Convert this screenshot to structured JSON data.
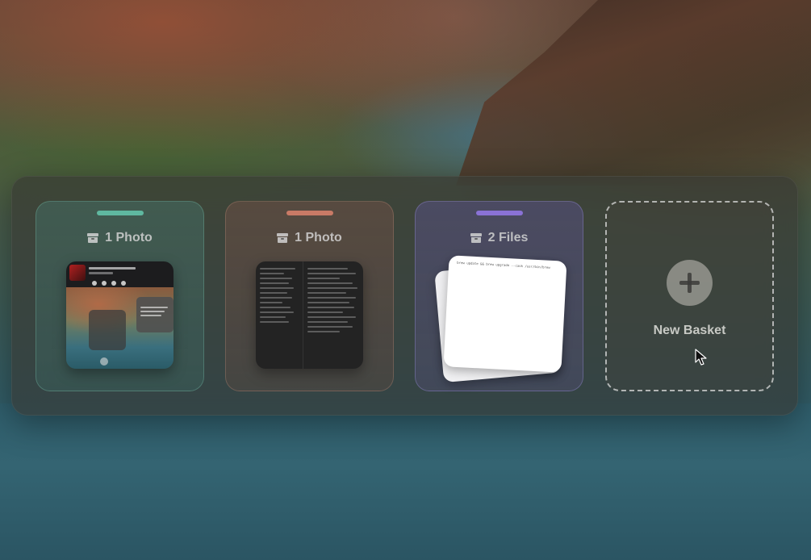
{
  "baskets": [
    {
      "title": "1 Photo",
      "accent": "#5fb8a0",
      "icon": "archive-box-icon",
      "thumbnail": "screenshot-photo"
    },
    {
      "title": "1 Photo",
      "accent": "#c97a66",
      "icon": "archive-box-icon",
      "thumbnail": "document-screenshot"
    },
    {
      "title": "2 Files",
      "accent": "#8a72d6",
      "icon": "archive-box-icon",
      "thumbnail": "stacked-files"
    }
  ],
  "new_basket": {
    "label": "New Basket",
    "icon": "plus-icon"
  },
  "file_preview_text": "brew update && brew upgrade --cask /usr/bin/brew",
  "colors": {
    "panel_background": "#3a3a35",
    "text_muted": "#d2d2d2"
  }
}
